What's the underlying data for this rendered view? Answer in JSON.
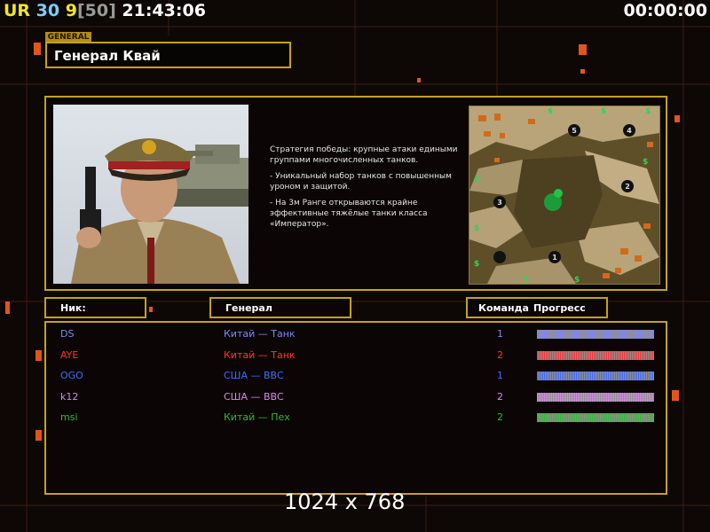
{
  "hud": {
    "left_segments": [
      {
        "text": "UR",
        "color": "#f2e626"
      },
      {
        "text": " 30",
        "color": "#7ad0ff"
      },
      {
        "text": " 9",
        "color": "#f2e626"
      },
      {
        "text": "[50]",
        "color": "#9a9a9a"
      },
      {
        "text": " 21:43:06",
        "color": "#ffffff"
      }
    ],
    "timer": "00:00:00"
  },
  "general": {
    "tab_label": "GENERAL",
    "name": "Генерал Квай"
  },
  "description": {
    "paragraphs": [
      "Стратегия победы: крупные атаки едиными\n группами многочисленных танков.",
      "- Уникальный набор танков с повышенным\n уроном и защитой.",
      "- На 3м Ранге открываются крайне\n эффективные тяжёлые танки класса\n «Император»."
    ]
  },
  "minimap": {
    "spawn_numbers": [
      "1",
      "2",
      "3",
      "4",
      "5"
    ],
    "money_symbol": "$"
  },
  "table": {
    "headers": {
      "nick": "Ник:",
      "general": "Генерал",
      "team": "Команда",
      "progress": "Прогресс"
    },
    "rows": [
      {
        "nick": "DS",
        "general": "Китай — Танк",
        "team": "1",
        "color": "#7f86ff",
        "progress": 1.0
      },
      {
        "nick": "AYE",
        "general": "Китай — Танк",
        "team": "2",
        "color": "#ff3333",
        "progress": 1.0
      },
      {
        "nick": "OGO",
        "general": "США — ВВС",
        "team": "1",
        "color": "#3f6cff",
        "progress": 1.0
      },
      {
        "nick": "k12",
        "general": "США — ВВС",
        "team": "2",
        "color": "#d48ce6",
        "progress": 1.0
      },
      {
        "nick": "msi",
        "general": "Китай — Пех",
        "team": "2",
        "color": "#37b537",
        "progress": 1.0
      }
    ]
  },
  "resolution_label": "1024 x 768"
}
